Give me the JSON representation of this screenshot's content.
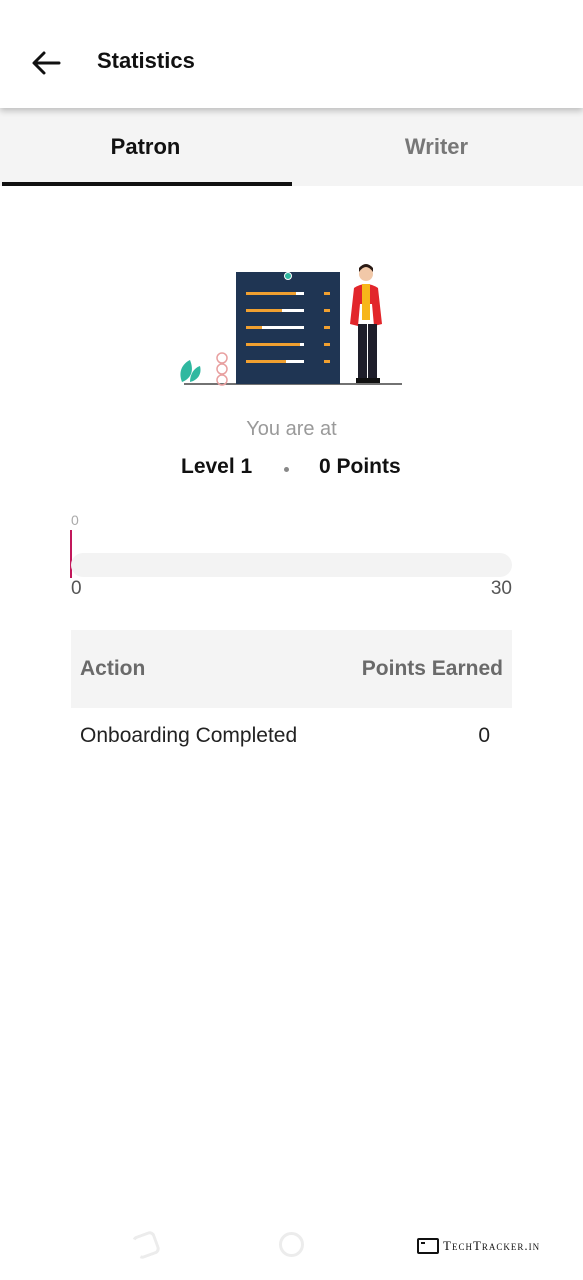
{
  "appbar": {
    "title": "Statistics",
    "back_icon": "arrow-left-icon"
  },
  "tabs": [
    {
      "label": "Patron",
      "active": true
    },
    {
      "label": "Writer",
      "active": false
    }
  ],
  "illustration": {
    "name": "leaderboard-person-illustration"
  },
  "status": {
    "subtitle": "You are at",
    "level": "Level 1",
    "points": "0 Points"
  },
  "progress": {
    "current_label": "0",
    "current": 0,
    "min_label": "0",
    "max_label": "30",
    "accent_color": "#c2185b"
  },
  "table": {
    "headers": {
      "action": "Action",
      "points": "Points Earned"
    },
    "rows": [
      {
        "action": "Onboarding Completed",
        "points": "0"
      }
    ]
  },
  "watermark": {
    "text": "TechTracker.in"
  }
}
